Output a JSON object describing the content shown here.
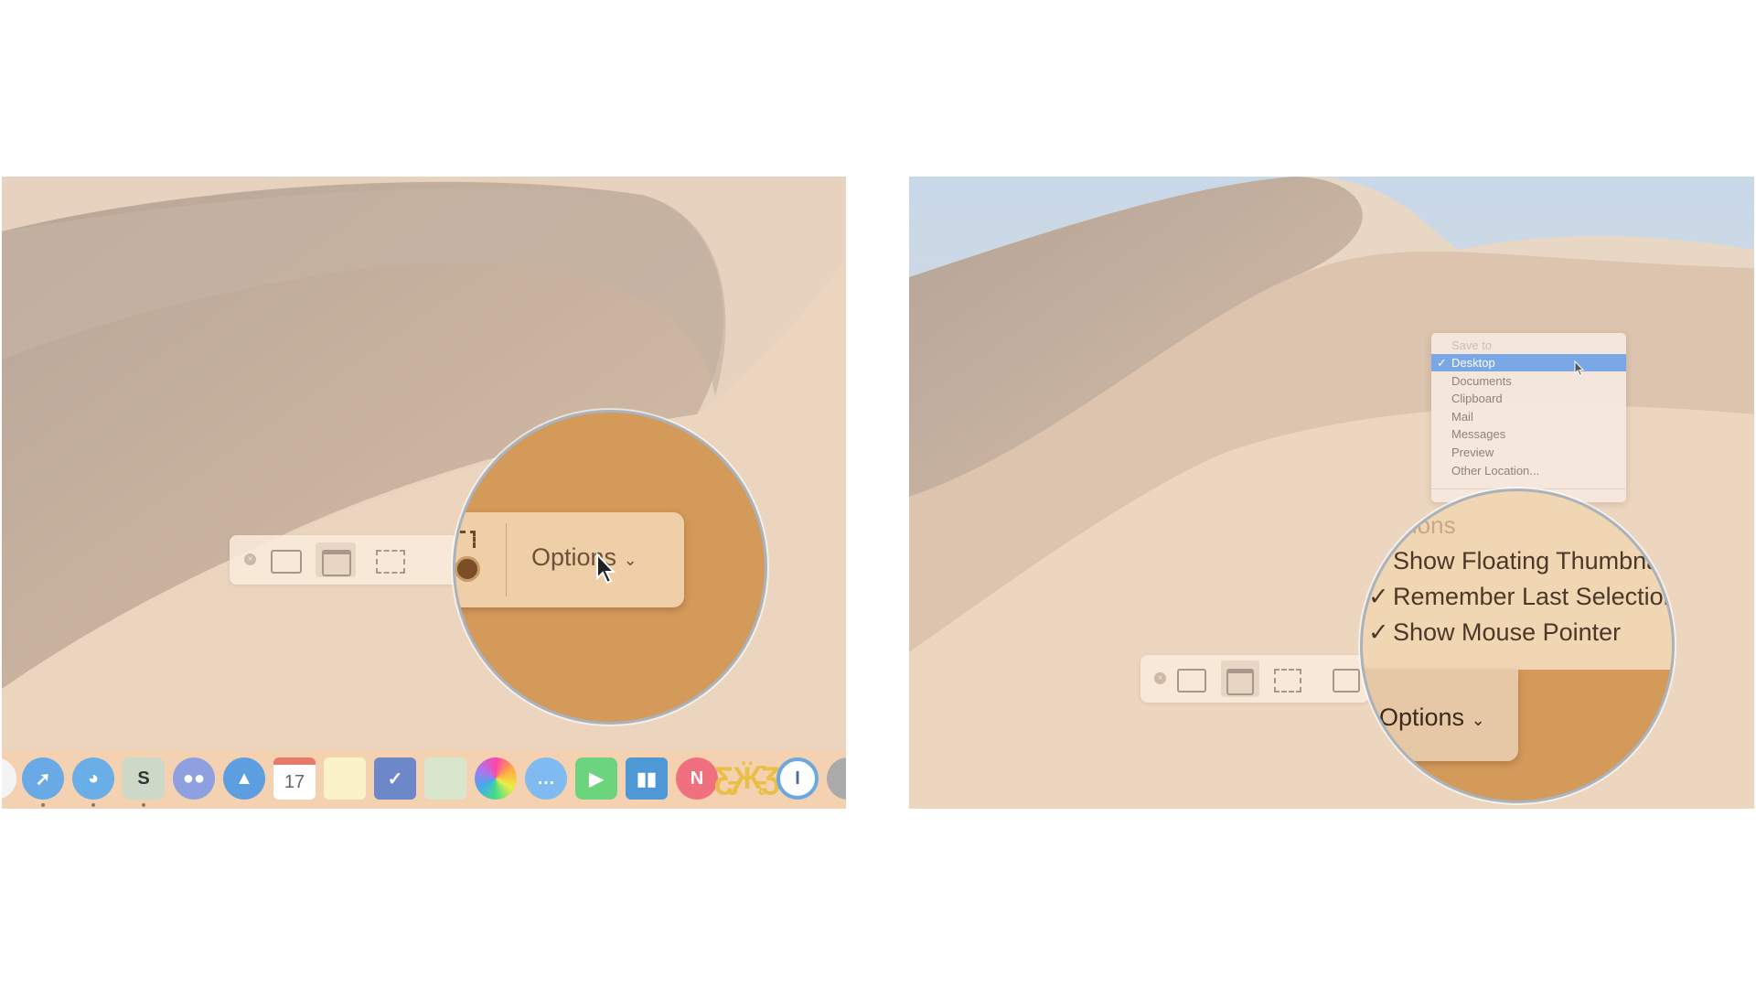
{
  "left": {
    "toolbar": {
      "close_icon": "close-x-icon",
      "tools": [
        "capture-entire-screen-icon",
        "capture-window-icon",
        "capture-selection-icon"
      ]
    },
    "magnifier": {
      "options_label": "Options",
      "chevron": "⌄"
    },
    "dock": {
      "apps": [
        "finder",
        "safari",
        "tweetbot",
        "slack",
        "discord",
        "spark",
        "calendar",
        "notes",
        "omnifocus",
        "maps",
        "photos",
        "messages",
        "facetime",
        "trello",
        "news",
        "tes",
        "1password",
        "system-preferences"
      ],
      "calendar_day": "17",
      "slack_letter": "S"
    }
  },
  "right": {
    "save_menu": {
      "header": "Save to",
      "items": [
        {
          "label": "Desktop",
          "checked": true,
          "highlighted": true
        },
        {
          "label": "Documents",
          "checked": false
        },
        {
          "label": "Clipboard",
          "checked": false
        },
        {
          "label": "Mail",
          "checked": false
        },
        {
          "label": "Messages",
          "checked": false
        },
        {
          "label": "Preview",
          "checked": false
        },
        {
          "label": "Other Location...",
          "checked": false
        }
      ]
    },
    "magnifier": {
      "options_header": "Options",
      "items": [
        {
          "label": "Show Floating Thumbnail",
          "checked": false
        },
        {
          "label": "Remember Last Selection",
          "checked": true
        },
        {
          "label": "Show Mouse Pointer",
          "checked": true
        }
      ],
      "options_label": "Options"
    }
  },
  "colors": {
    "highlight": "#7aa8e6",
    "sand": "#e9cdb1",
    "magnified": "#d49a5a"
  }
}
